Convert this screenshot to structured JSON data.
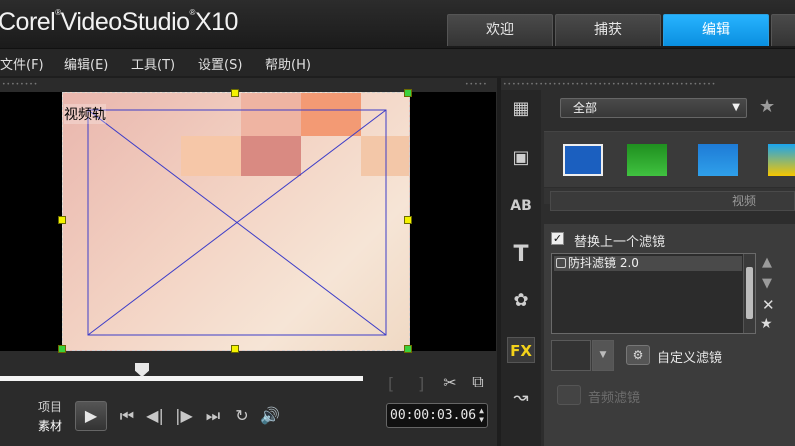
{
  "app": {
    "brand_prefix": "Corel",
    "brand_name": "VideoStudio",
    "brand_version": "X10"
  },
  "tabs": [
    {
      "label": "欢迎"
    },
    {
      "label": "捕获"
    },
    {
      "label": "编辑",
      "active": true
    }
  ],
  "menu": [
    "文件(F)",
    "编辑(E)",
    "工具(T)",
    "设置(S)",
    "帮助(H)"
  ],
  "preview": {
    "track_label": "视频轨",
    "mode_labels": [
      "项目",
      "素材"
    ],
    "timecode": "00:00:03.06",
    "bracket_in": "[",
    "bracket_out": "]"
  },
  "library": {
    "category": "全部",
    "section_label": "视频",
    "replace_filter_label": "替换上一个滤镜",
    "replace_filter_checked": true,
    "applied_filters": [
      "防抖滤镜 2.0"
    ],
    "custom_filter_label": "自定义滤镜",
    "audio_filter_label": "音频滤镜"
  },
  "colors": {
    "accent_tab": "#0a8fe0",
    "handle": "#f4f200",
    "fx_icon": "#f3d21a"
  },
  "icons": {
    "sidebar": [
      "media-icon",
      "instant-project-icon",
      "title-icon",
      "text-icon",
      "graphic-icon",
      "fx-filter-icon",
      "path-icon"
    ],
    "fx_label": "FX"
  }
}
